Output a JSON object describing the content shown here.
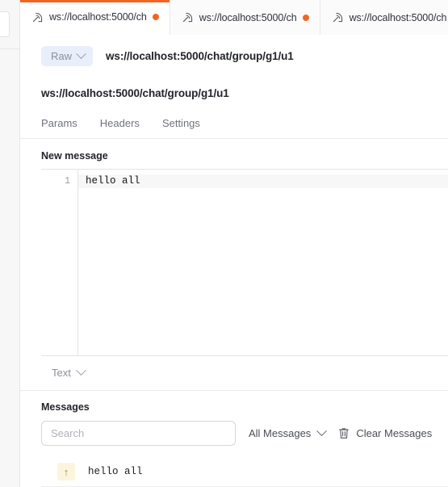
{
  "window": {
    "accent_color": "#f26522",
    "tab_indicator_color": "#f26522"
  },
  "tabbar": {
    "add_tab_label": "+",
    "tabs": [
      {
        "icon": "websocket-icon",
        "label": "ws://localhost:5000/ch",
        "status_dot": "connected",
        "active": true
      },
      {
        "icon": "websocket-icon",
        "label": "ws://localhost:5000/ch",
        "status_dot": "connected",
        "active": false
      },
      {
        "icon": "websocket-icon",
        "label": "ws://localhost:5000/ch",
        "status_dot": "connected",
        "active": false
      }
    ]
  },
  "url_bar": {
    "mode_label": "Raw",
    "url": "ws://localhost:5000/chat/group/g1/u1"
  },
  "request": {
    "title": "ws://localhost:5000/chat/group/g1/u1",
    "subtabs": [
      {
        "label": "Params"
      },
      {
        "label": "Headers"
      },
      {
        "label": "Settings"
      }
    ]
  },
  "compose": {
    "section_label": "New message",
    "line_number": "1",
    "content": "hello all",
    "format_label": "Text"
  },
  "messages": {
    "section_label": "Messages",
    "search_placeholder": "Search",
    "search_value": "",
    "filter_label": "All Messages",
    "clear_label": "Clear Messages",
    "rows": [
      {
        "direction": "sent",
        "direction_glyph": "↑",
        "text": "hello all"
      }
    ]
  }
}
